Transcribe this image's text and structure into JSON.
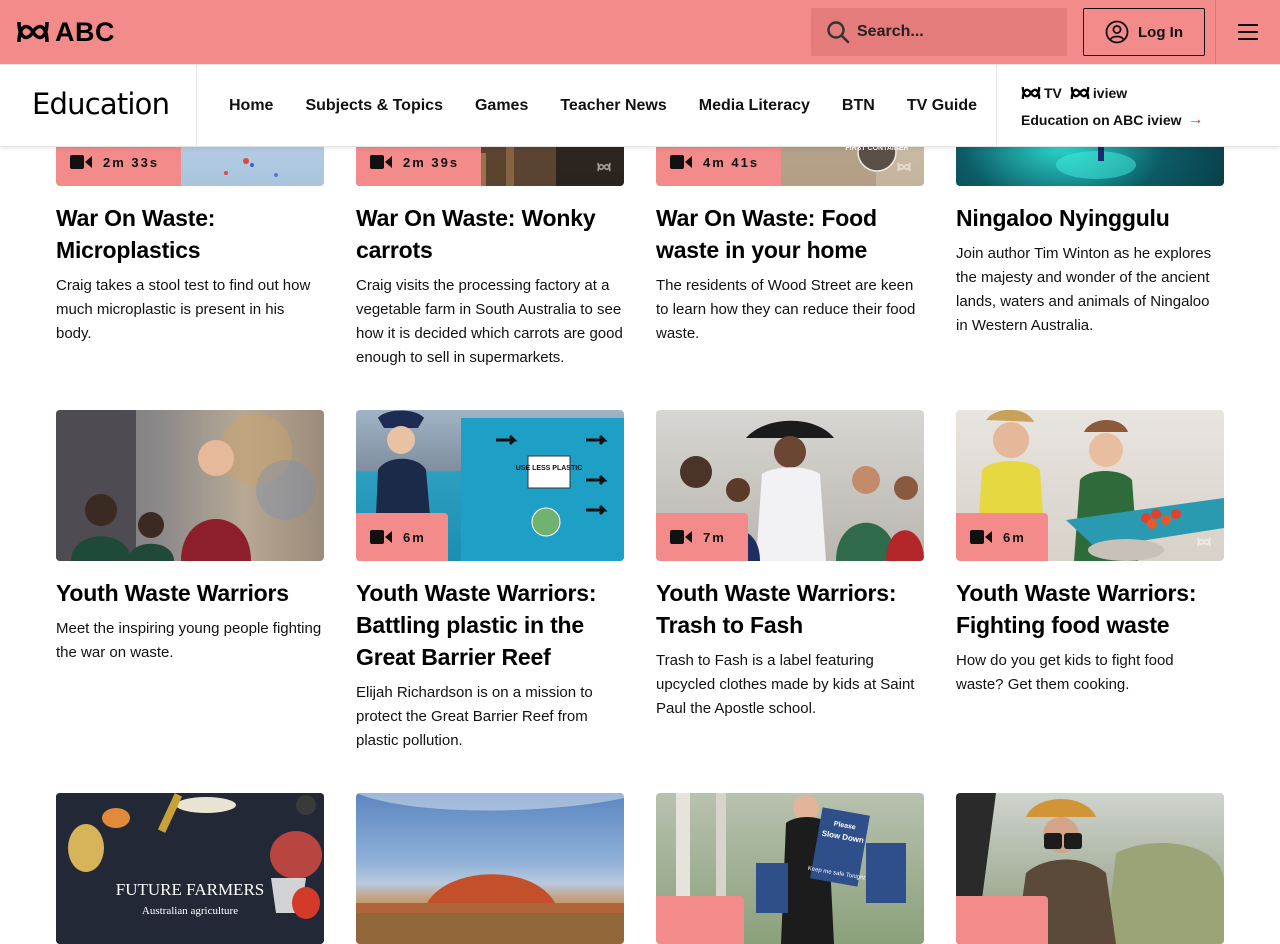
{
  "header": {
    "brand": "ABC",
    "search_placeholder": "Search...",
    "login_label": "Log In"
  },
  "section": {
    "title": "Education",
    "nav": [
      "Home",
      "Subjects & Topics",
      "Games",
      "Teacher News",
      "Media Literacy",
      "BTN",
      "TV Guide"
    ],
    "iview_logo_tv": "TV",
    "iview_logo_iview": "iview",
    "iview_link": "Education on ABC iview"
  },
  "cards_row1": [
    {
      "duration": "2m 33s",
      "title": "War On Waste: Microplastics",
      "desc": "Craig takes a stool test to find out how much microplastic is present in his body."
    },
    {
      "duration": "2m 39s",
      "title": "War On Waste: Wonky carrots",
      "desc": "Craig visits the processing factory at a vegetable farm in South Australia to see how it is decided which carrots are good enough to sell in supermarkets."
    },
    {
      "duration": "4m 41s",
      "title": "War On Waste: Food waste in your home",
      "desc": "The residents of Wood Street are keen to learn how they can reduce their food waste."
    },
    {
      "duration": "",
      "title": "Ningaloo Nyinggulu",
      "desc": "Join author Tim Winton as he explores the majesty and wonder of the ancient lands, waters and animals of Ningaloo in Western Australia."
    }
  ],
  "cards_row2": [
    {
      "duration": "",
      "title": "Youth Waste Warriors",
      "desc": "Meet the inspiring young people fighting the war on waste."
    },
    {
      "duration": "6m",
      "title": "Youth Waste Warriors: Battling plastic in the Great Barrier Reef",
      "desc": "Elijah Richardson is on a mission to protect the Great Barrier Reef from plastic pollution.",
      "sign_text": "USE LESS PLASTIC"
    },
    {
      "duration": "7m",
      "title": "Youth Waste Warriors: Trash to Fash",
      "desc": "Trash to Fash is a label featuring upcycled clothes made by kids at Saint Paul the Apostle school."
    },
    {
      "duration": "6m",
      "title": "Youth Waste Warriors: Fighting food waste",
      "desc": "How do you get kids to fight food waste? Get them cooking."
    }
  ],
  "cards_row3": [
    {
      "thumb_title": "FUTURE FARMERS",
      "thumb_subtitle": "Australian agriculture"
    },
    {},
    {
      "sign_top": "Please",
      "sign_main": "Slow Down",
      "sign_sub": "Keep me safe Tonight"
    },
    {}
  ],
  "thumb_text_c": "FIRST CONTAINER",
  "colors": {
    "brand": "#f38b8b",
    "search_bg": "#e57c7c",
    "badge": "#f38b8b"
  }
}
